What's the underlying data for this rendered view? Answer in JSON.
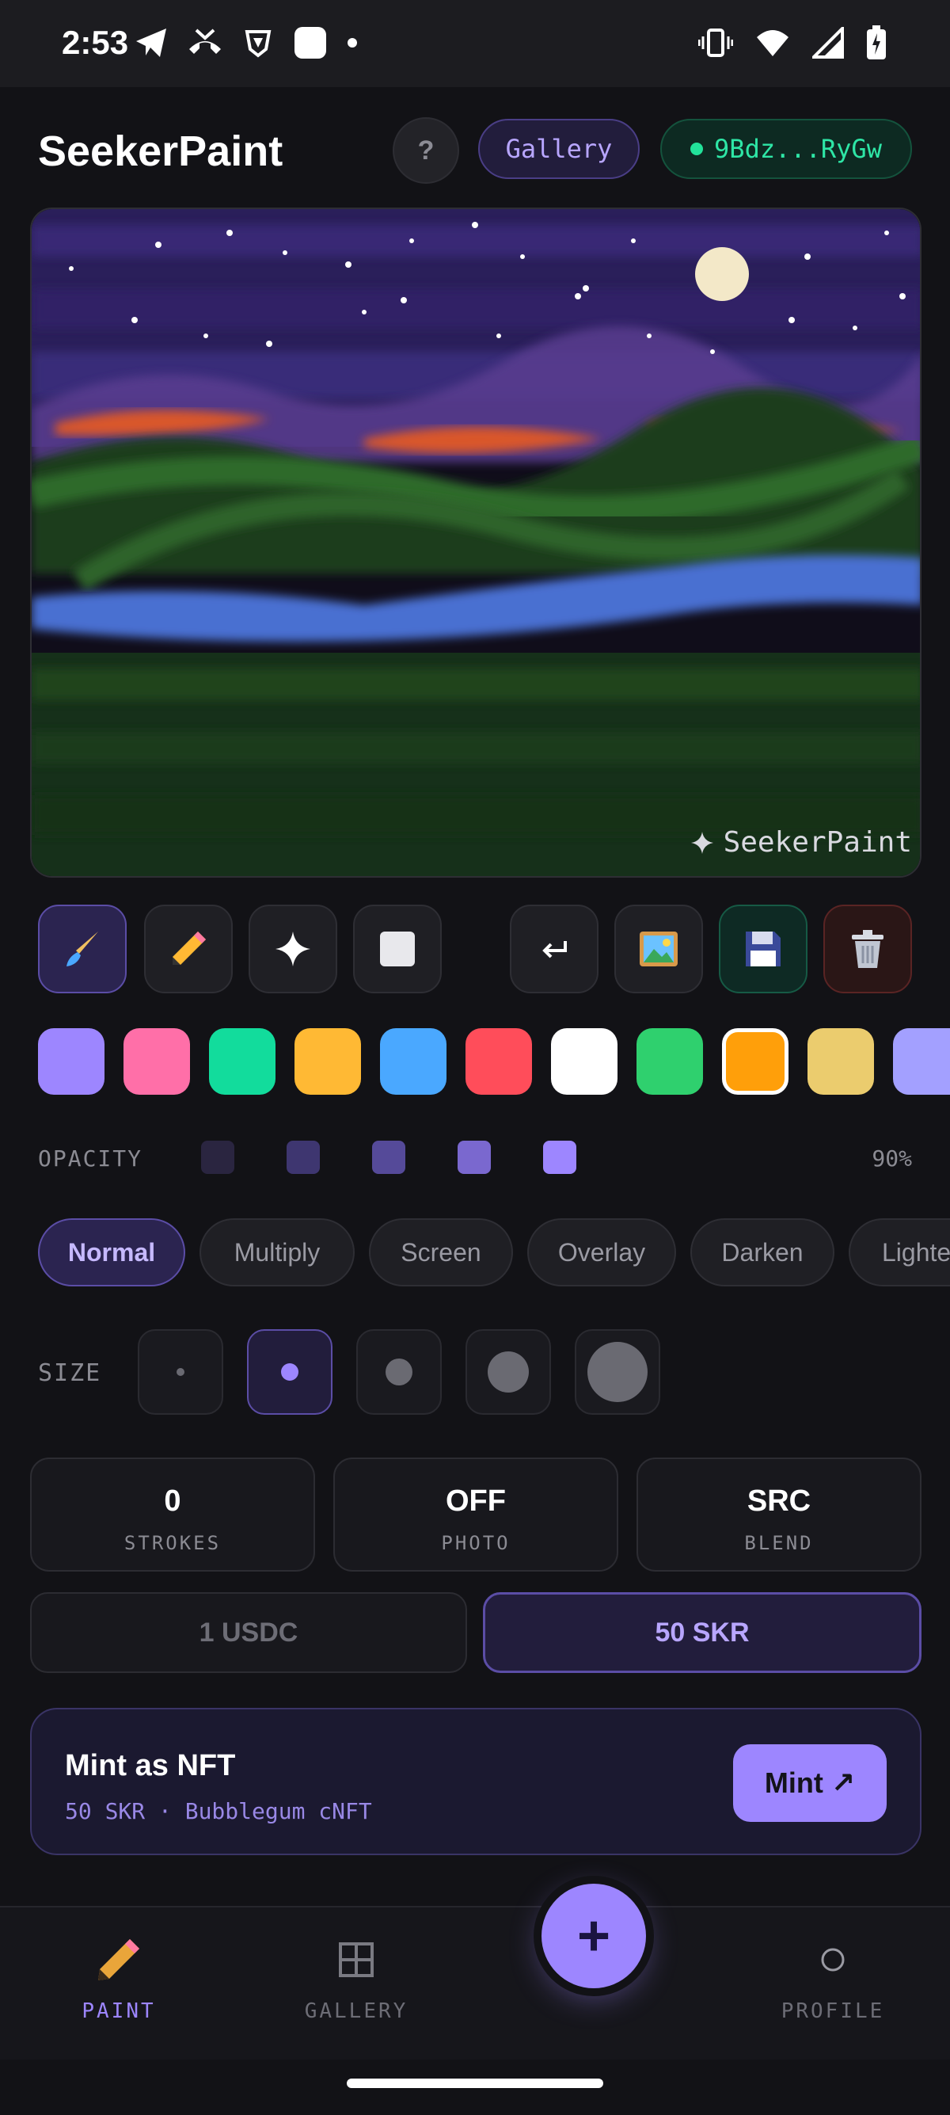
{
  "status_bar": {
    "time": "2:53"
  },
  "header": {
    "title": "SeekerPaint",
    "help_label": "?",
    "gallery_label": "Gallery",
    "wallet_label": "9Bdz...RyGw"
  },
  "canvas": {
    "watermark": "SeekerPaint"
  },
  "toolbar": {
    "tools": [
      "brush-icon",
      "pencil-icon",
      "sparkle-icon",
      "eraser-icon"
    ],
    "actions": [
      "undo-icon",
      "image-icon",
      "save-icon",
      "trash-icon"
    ]
  },
  "palette": {
    "colors": [
      "#9d86ff",
      "#ff6fa8",
      "#12dc9c",
      "#ffb934",
      "#4aa8ff",
      "#ff4d5a",
      "#ffffff",
      "#2fd06e",
      "#ff9f0a",
      "#ebcc6e",
      "#a3a0ff"
    ],
    "selected_index": 8
  },
  "opacity": {
    "label": "OPACITY",
    "value": "90%"
  },
  "blend_modes": {
    "options": [
      "Normal",
      "Multiply",
      "Screen",
      "Overlay",
      "Darken",
      "Lighten"
    ],
    "selected": "Normal"
  },
  "size": {
    "label": "SIZE",
    "selected_index": 1
  },
  "stats": [
    {
      "value": "0",
      "label": "STROKES"
    },
    {
      "value": "OFF",
      "label": "PHOTO"
    },
    {
      "value": "SRC",
      "label": "BLEND"
    }
  ],
  "currency": {
    "usdc": "1 USDC",
    "skr": "50 SKR",
    "selected": "50 SKR"
  },
  "mint": {
    "title": "Mint as NFT",
    "subtitle": "50 SKR · Bubblegum cNFT",
    "button": "Mint ↗"
  },
  "nav": {
    "paint": "PAINT",
    "gallery": "GALLERY",
    "profile": "PROFILE",
    "fab": "+"
  }
}
